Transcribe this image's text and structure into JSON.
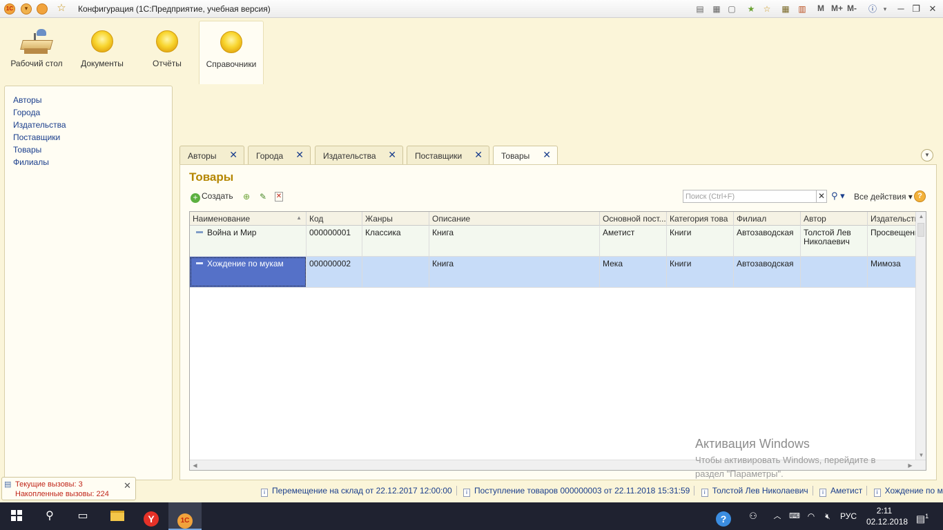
{
  "window": {
    "title": "Конфигурация  (1С:Предприятие, учебная версия)",
    "logo_text": "1С",
    "toolbar_letters": [
      "M",
      "M+",
      "M-"
    ]
  },
  "sections": [
    {
      "label": "Рабочий стол",
      "icon": "desktop-icon",
      "active": false
    },
    {
      "label": "Документы",
      "icon": "section-ball-icon",
      "active": false
    },
    {
      "label": "Отчёты",
      "icon": "section-ball-icon",
      "active": false
    },
    {
      "label": "Справочники",
      "icon": "section-ball-icon",
      "active": true
    }
  ],
  "nav": {
    "items": [
      "Авторы",
      "Города",
      "Издательства",
      "Поставщики",
      "Товары",
      "Филиалы"
    ]
  },
  "tabs": [
    {
      "label": "Авторы",
      "active": false
    },
    {
      "label": "Города",
      "active": false
    },
    {
      "label": "Издательства",
      "active": false
    },
    {
      "label": "Поставщики",
      "active": false
    },
    {
      "label": "Товары",
      "active": true
    }
  ],
  "form": {
    "title": "Товары",
    "create_label": "Создать",
    "search_placeholder": "Поиск (Ctrl+F)",
    "all_actions_label": "Все действия",
    "help_label": "?"
  },
  "table": {
    "columns": [
      "Наименование",
      "Код",
      "Жанры",
      "Описание",
      "Основной пост...",
      "Категория това",
      "Филиал",
      "Автор",
      "Издательств"
    ],
    "rows": [
      [
        "Война и Мир",
        "000000001",
        "Классика",
        "Книга",
        "Аметист",
        "Книги",
        "Автозаводская",
        "Толстой Лев Николаевич",
        "Просвещени"
      ],
      [
        "Хождение по мукам",
        "000000002",
        "",
        "Книга",
        "Мека",
        "Книги",
        "Автозаводская",
        "",
        "Мимоза"
      ]
    ],
    "selected_row": 1
  },
  "activation": {
    "title": "Активация Windows",
    "text": "Чтобы активировать Windows, перейдите в раздел \"Параметры\"."
  },
  "calls": {
    "current": "Текущие вызовы: 3",
    "total": "Накопленные вызовы: 224"
  },
  "history": [
    "Перемещение на склад  от 22.12.2017 12:00:00",
    "Поступление товаров 000000003 от 22.11.2018 15:31:59",
    "Толстой Лев Николаевич",
    "Аметист",
    "Хождение по мукам"
  ],
  "taskbar": {
    "language": "РУС",
    "time": "2:11",
    "date": "02.12.2018",
    "notification_count": "1"
  }
}
